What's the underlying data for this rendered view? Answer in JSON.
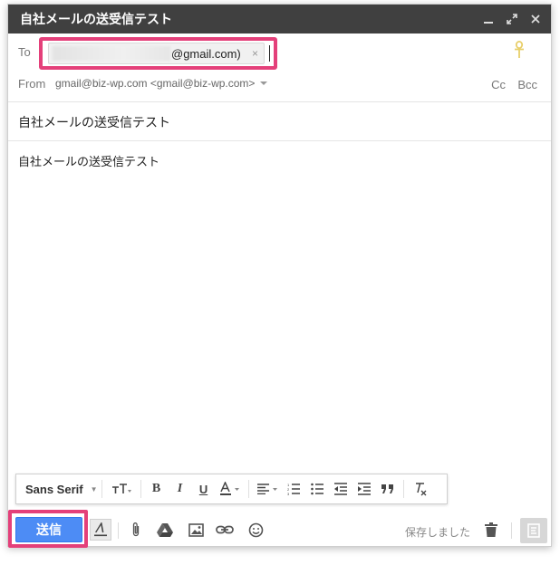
{
  "window": {
    "title": "自社メールの送受信テスト",
    "controls": [
      "minimize-icon",
      "expand-icon",
      "close-icon"
    ]
  },
  "to": {
    "label": "To",
    "recipient": "@gmail.com)",
    "remove": "×"
  },
  "from": {
    "label": "From",
    "value": "gmail@biz-wp.com <gmail@biz-wp.com>",
    "cc": "Cc",
    "bcc": "Bcc"
  },
  "subject": "自社メールの送受信テスト",
  "body": "自社メールの送受信テスト",
  "format_toolbar": {
    "font": "Sans Serif",
    "items": [
      "font-size-icon",
      "bold-icon",
      "italic-icon",
      "underline-icon",
      "text-color-icon",
      "align-icon",
      "numbered-list-icon",
      "bulleted-list-icon",
      "indent-less-icon",
      "indent-more-icon",
      "quote-icon",
      "remove-formatting-icon"
    ]
  },
  "bottom": {
    "send_label": "送信",
    "status": "保存しました"
  },
  "colors": {
    "titlebar": "#404040",
    "send": "#4d8cf5",
    "highlight": "#e4407a"
  }
}
